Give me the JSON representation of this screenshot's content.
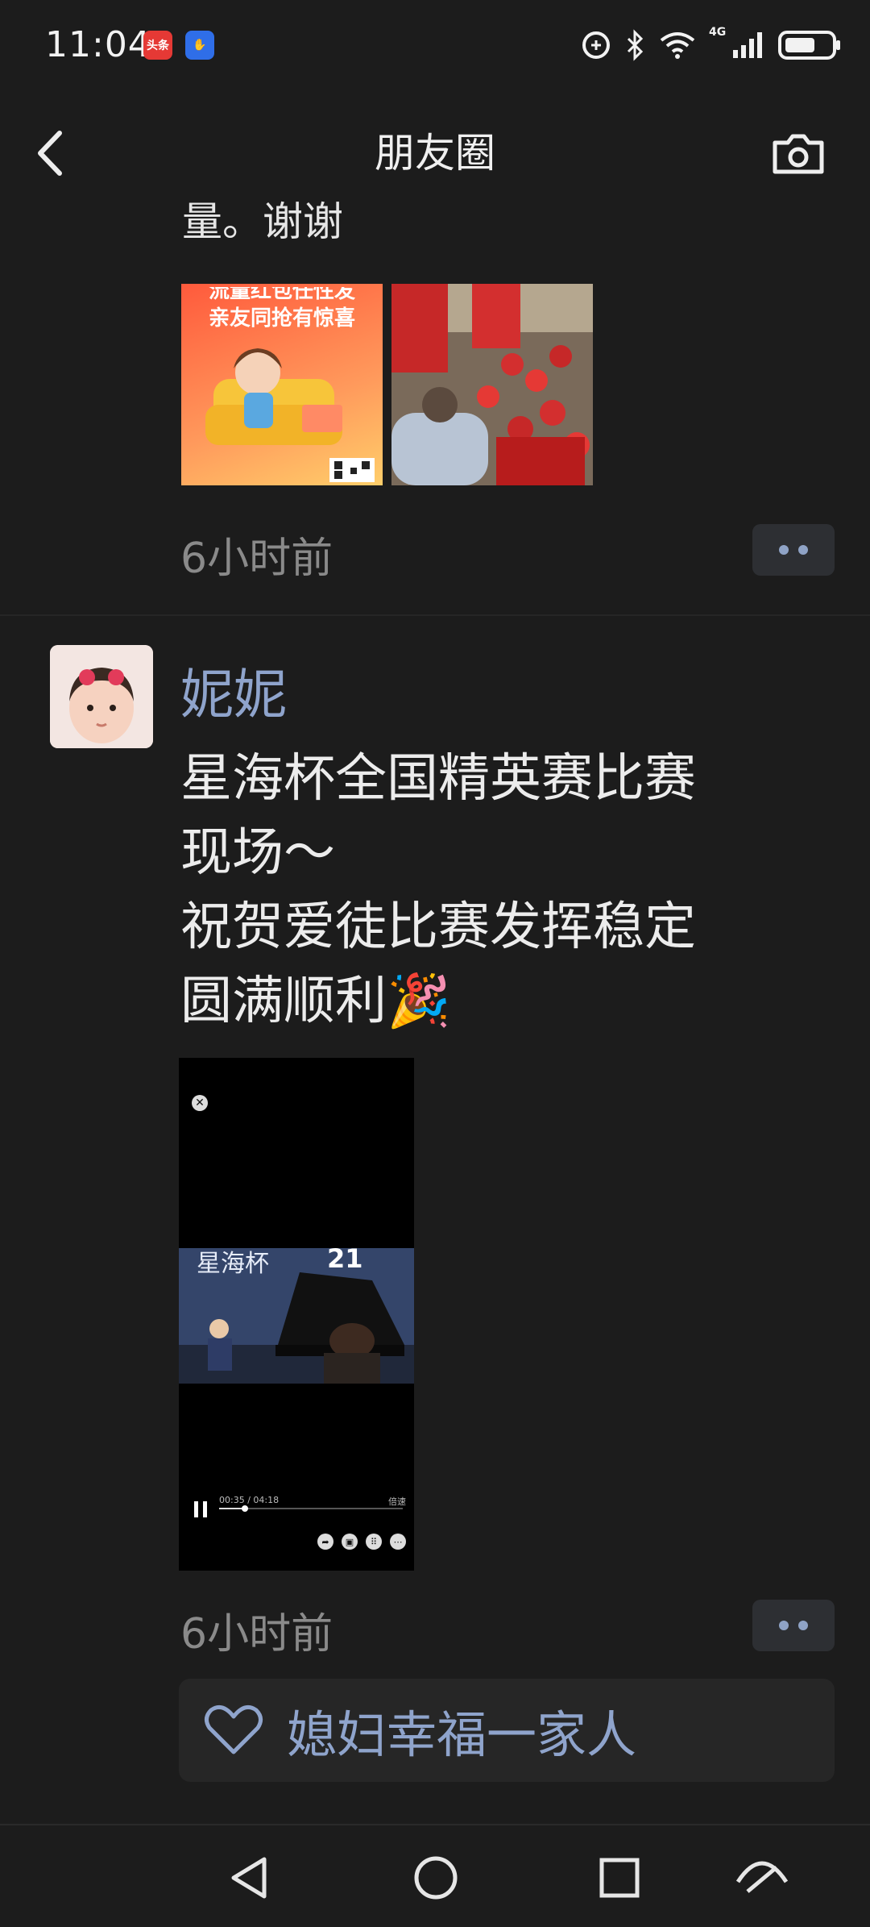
{
  "status_bar": {
    "time": "11:04",
    "badge_1_label": "头条",
    "network_type": "4G"
  },
  "header": {
    "title": "朋友圈"
  },
  "previous_post": {
    "truncated_text": "量。谢谢",
    "time": "6小时前",
    "image_1_text_line1": "流量红包任性发",
    "image_1_text_line2": "亲友同抢有惊喜"
  },
  "post": {
    "username": "妮妮",
    "text": "星海杯全国精英赛比赛\n现场～\n祝贺爱徒比赛发挥稳定\n圆满顺利🎉",
    "time": "6小时前",
    "video": {
      "banner_text": "星海杯",
      "banner_number": "21",
      "time_display": "00:35 / 04:18",
      "progress": 0.14,
      "speed_label": "倍速"
    },
    "likes": [
      "媳妇幸福一家人"
    ]
  },
  "icons": {
    "back": "back-arrow-icon",
    "camera": "camera-icon",
    "like": "heart-icon",
    "nav_back": "triangle-back-icon",
    "nav_home": "circle-home-icon",
    "nav_recent": "square-recent-icon"
  },
  "colors": {
    "background": "#1c1c1c",
    "username": "#8fa4cc",
    "timestamp": "#8a8a8a"
  }
}
